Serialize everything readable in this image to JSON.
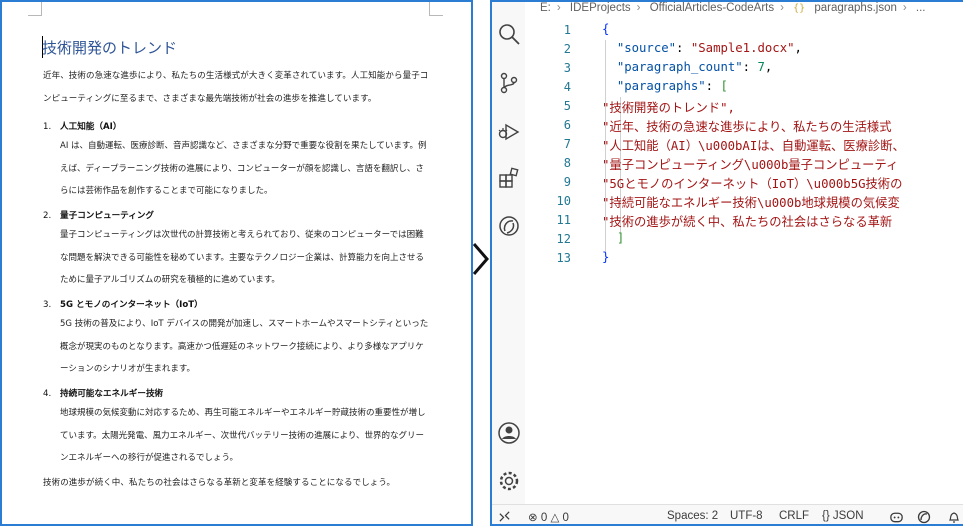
{
  "document": {
    "title": "技術開発のトレンド",
    "intro": "近年、技術の急速な進歩により、私たちの生活様式が大きく変革されています。人工知能から量子コンピューティングに至るまで、さまざまな最先端技術が社会の進歩を推進しています。",
    "sections": [
      {
        "number": "1.",
        "heading": "人工知能（AI）",
        "body": "AI は、自動運転、医療診断、音声認識など、さまざまな分野で重要な役割を果たしています。例えば、ディープラーニング技術の進展により、コンピューターが顔を認識し、言語を翻訳し、さらには芸術作品を創作することまで可能になりました。"
      },
      {
        "number": "2.",
        "heading": "量子コンピューティング",
        "body": "量子コンピューティングは次世代の計算技術と考えられており、従来のコンピューターでは困難な問題を解決できる可能性を秘めています。主要なテクノロジー企業は、計算能力を向上させるために量子アルゴリズムの研究を積極的に進めています。"
      },
      {
        "number": "3.",
        "heading": "5G とモノのインターネット（IoT）",
        "body": "5G 技術の普及により、IoT デバイスの開発が加速し、スマートホームやスマートシティといった概念が現実のものとなります。高速かつ低遅延のネットワーク接続により、より多様なアプリケーションのシナリオが生まれます。"
      },
      {
        "number": "4.",
        "heading": "持続可能なエネルギー技術",
        "body": "地球規模の気候変動に対応するため、再生可能エネルギーやエネルギー貯蔵技術の重要性が増しています。太陽光発電、風力エネルギー、次世代バッテリー技術の進展により、世界的なグリーンエネルギーへの移行が促進されるでしょう。"
      }
    ],
    "closing": "技術の進歩が続く中、私たちの社会はさらなる革新と変革を経験することになるでしょう。"
  },
  "editor": {
    "breadcrumb": [
      "E:",
      "IDEProjects",
      "OfficialArticles-CodeArts",
      "paragraphs.json",
      "..."
    ],
    "json_icon": "{}",
    "line_numbers": [
      "1",
      "2",
      "3",
      "4",
      "5",
      "6",
      "7",
      "8",
      "9",
      "10",
      "11",
      "12",
      "13"
    ],
    "source_key": "\"source\"",
    "source_value": "\"Sample1.docx\"",
    "count_key": "\"paragraph_count\"",
    "count_value": "7",
    "paragraphs_key": "\"paragraphs\"",
    "lines": [
      "\"技術開発のトレンド\",",
      "\"近年、技術の急速な進歩により、私たちの生活様式",
      "\"人工知能（AI）\\u000bAIは、自動運転、医療診断、",
      "\"量子コンピューティング\\u000b量子コンピューティ",
      "\"5Gとモノのインターネット（IoT）\\u000b5G技術の",
      "\"持続可能なエネルギー技術\\u000b地球規模の気候変",
      "\"技術の進歩が続く中、私たちの社会はさらなる革新"
    ]
  },
  "status_bar": {
    "errors": "0",
    "warnings": "0",
    "spaces": "Spaces: 2",
    "encoding": "UTF-8",
    "eol": "CRLF",
    "language": "JSON"
  },
  "icons": {
    "activity": [
      "search-icon",
      "source-control-icon",
      "run-debug-icon",
      "extensions-icon",
      "copilot-chat-icon",
      "account-icon",
      "settings-gear-icon"
    ],
    "status": [
      "remote-icon",
      "error-icon",
      "warning-icon",
      "copilot-icon",
      "copilot-status-icon",
      "bell-icon"
    ]
  },
  "colors": {
    "focus_border": "#2b7cd3",
    "doc_title": "#2f5597",
    "json_key": "#0451a5",
    "json_string": "#a31515",
    "json_number": "#098658"
  }
}
